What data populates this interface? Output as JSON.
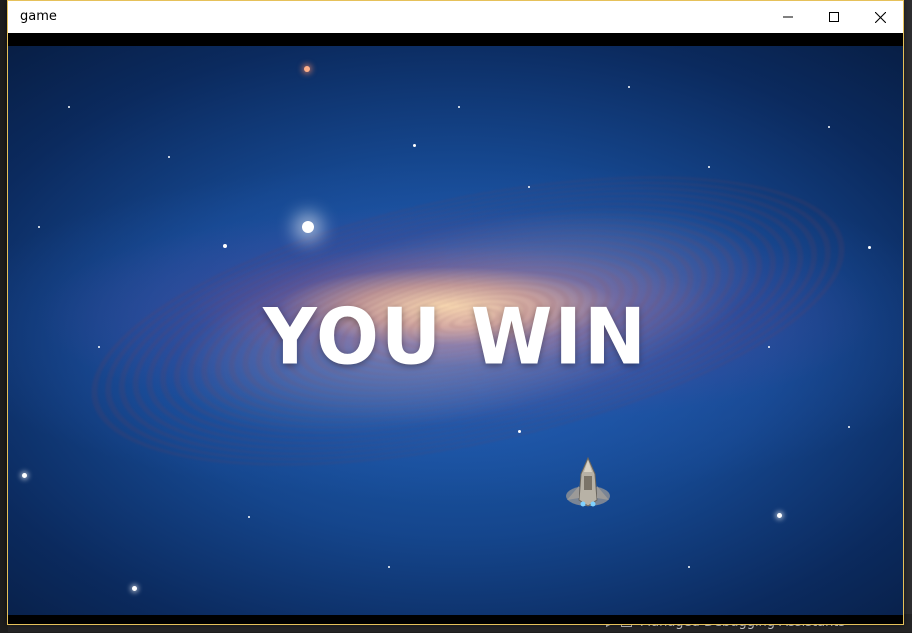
{
  "window": {
    "title": "game",
    "controls": {
      "minimize": "minimize-icon",
      "maximize": "maximize-icon",
      "close": "close-icon"
    }
  },
  "game": {
    "message": "YOU WIN",
    "player_ship_icon": "spaceship-icon",
    "background": "galaxy-starfield"
  },
  "background_ide": {
    "bottom_item_label": "Managed Debugging Assistants"
  },
  "colors": {
    "window_border": "#e6c15a",
    "titlebar_bg": "#ffffff",
    "message_text": "#ffffff",
    "space_blue": "#15468d"
  }
}
